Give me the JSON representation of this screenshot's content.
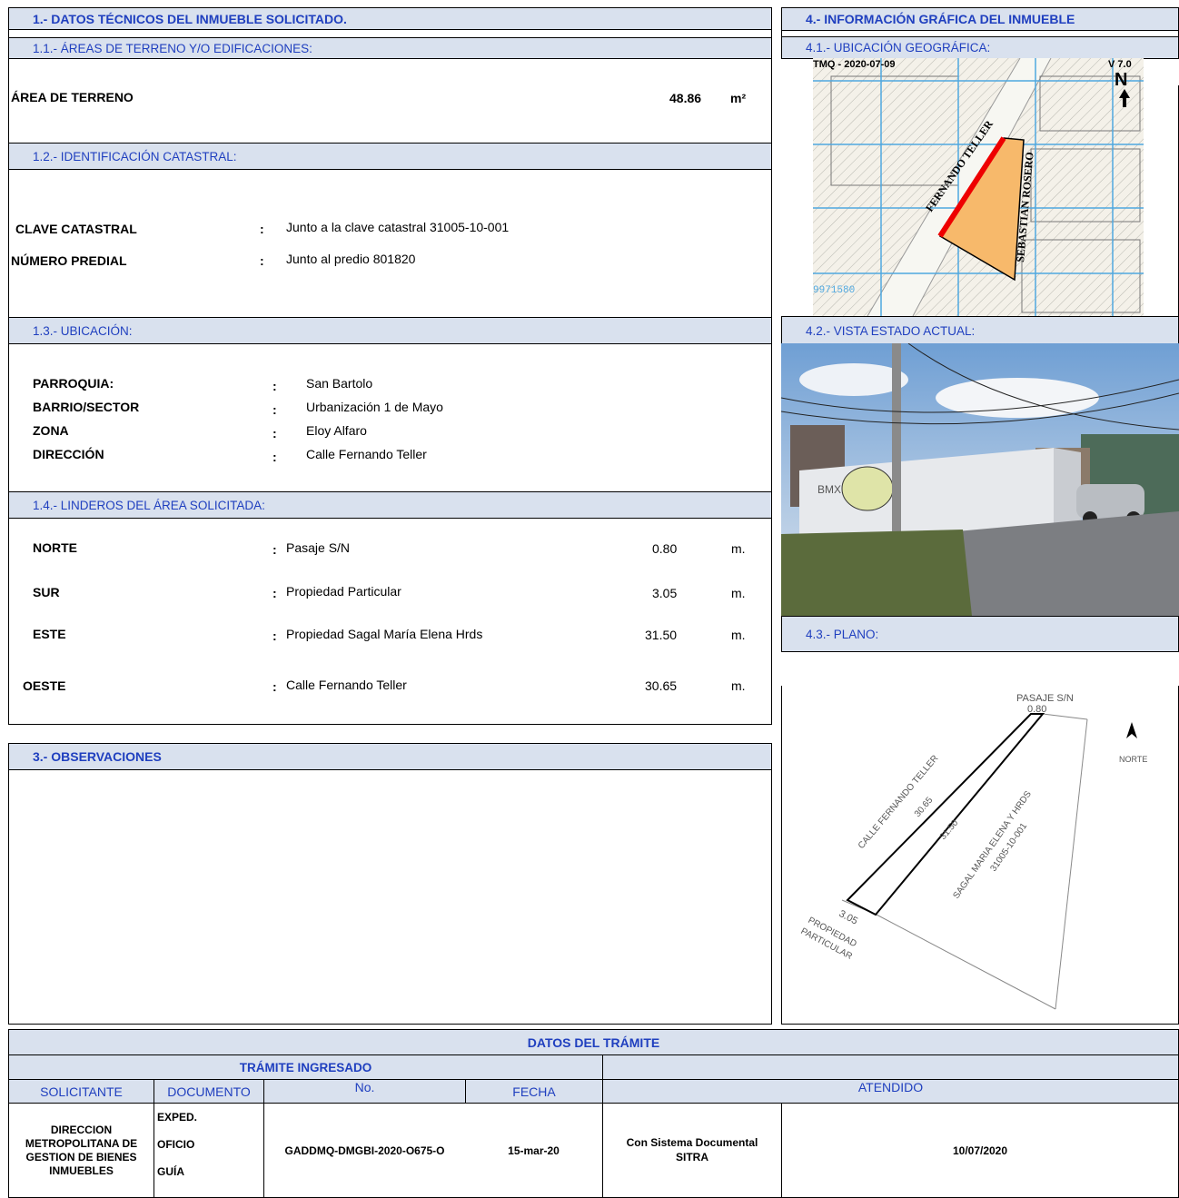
{
  "section1": {
    "title": "1.- DATOS TÉCNICOS DEL INMUEBLE SOLICITADO.",
    "s11_title": "1.1.- ÁREAS DE TERRENO Y/O EDIFICACIONES:",
    "area_label": "ÁREA DE TERRENO",
    "area_value": "48.86",
    "area_unit": "m²",
    "s12_title": "1.2.- IDENTIFICACIÓN CATASTRAL:",
    "clave_label": "CLAVE CATASTRAL",
    "clave_value": "Junto a la clave catastral 31005-10-001",
    "predial_label": "NÚMERO PREDIAL",
    "predial_value": "Junto al predio 801820",
    "s13_title": "1.3.- UBICACIÓN:",
    "parroquia_label": "PARROQUIA:",
    "parroquia_value": "San Bartolo",
    "barrio_label": "BARRIO/SECTOR",
    "barrio_value": "Urbanización 1 de Mayo",
    "zona_label": "ZONA",
    "zona_value": "Eloy Alfaro",
    "direccion_label": "DIRECCIÓN",
    "direccion_value": "Calle Fernando Teller",
    "s14_title": "1.4.- LINDEROS DEL ÁREA SOLICITADA:",
    "colon": ":",
    "linderos": [
      {
        "dir": "NORTE",
        "desc": "Pasaje S/N",
        "len": "0.80",
        "unit": "m."
      },
      {
        "dir": "SUR",
        "desc": "Propiedad Particular",
        "len": "3.05",
        "unit": "m."
      },
      {
        "dir": "ESTE",
        "desc": "Propiedad Sagal María Elena Hrds",
        "len": "31.50",
        "unit": "m."
      },
      {
        "dir": "OESTE",
        "desc": "Calle Fernando Teller",
        "len": "30.65",
        "unit": "m."
      }
    ]
  },
  "section3": {
    "title": "3.- OBSERVACIONES"
  },
  "section4": {
    "title": "4.- INFORMACIÓN GRÁFICA DEL INMUEBLE",
    "s41_title": "4.1.- UBICACIÓN GEOGRÁFICA:",
    "map_stamp": "TMQ - 2020-07-09",
    "map_version": "V 7.0",
    "map_north": "N",
    "map_street1": "FERNANDO TELLER",
    "map_street2": "SEBASTIAN ROSERO",
    "map_coord": "9971580",
    "s42_title": "4.2.- VISTA ESTADO ACTUAL:",
    "s43_title": "4.3.- PLANO:",
    "plan_pasaje": "PASAJE S/N",
    "plan_norte_len": "0.80",
    "plan_norte": "NORTE",
    "plan_calle": "CALLE FERNANDO TELLER",
    "plan_oeste_len": "30.65",
    "plan_este_len": "31.50",
    "plan_sagal": "SAGAL MARIA ELENA Y HRDS",
    "plan_clave": "31005-10-001",
    "plan_sur_len": "3.05",
    "plan_prop1": "PROPIEDAD",
    "plan_prop2": "PARTICULAR"
  },
  "tramite": {
    "title": "DATOS DEL TRÁMITE",
    "ingresado": "TRÁMITE INGRESADO",
    "h_solicitante": "SOLICITANTE",
    "h_documento": "DOCUMENTO",
    "h_no": "No.",
    "h_fecha": "FECHA",
    "h_atendido": "ATENDIDO",
    "solicitante": "DIRECCION METROPOLITANA DE GESTION DE BIENES INMUEBLES",
    "doc1": "EXPED.",
    "doc2": "OFICIO",
    "doc3": "GUÍA",
    "numero": "GADDMQ-DMGBI-2020-O675-O",
    "fecha": "15-mar-20",
    "atendido": "Con Sistema Documental SITRA",
    "atendido_fecha": "10/07/2020"
  }
}
